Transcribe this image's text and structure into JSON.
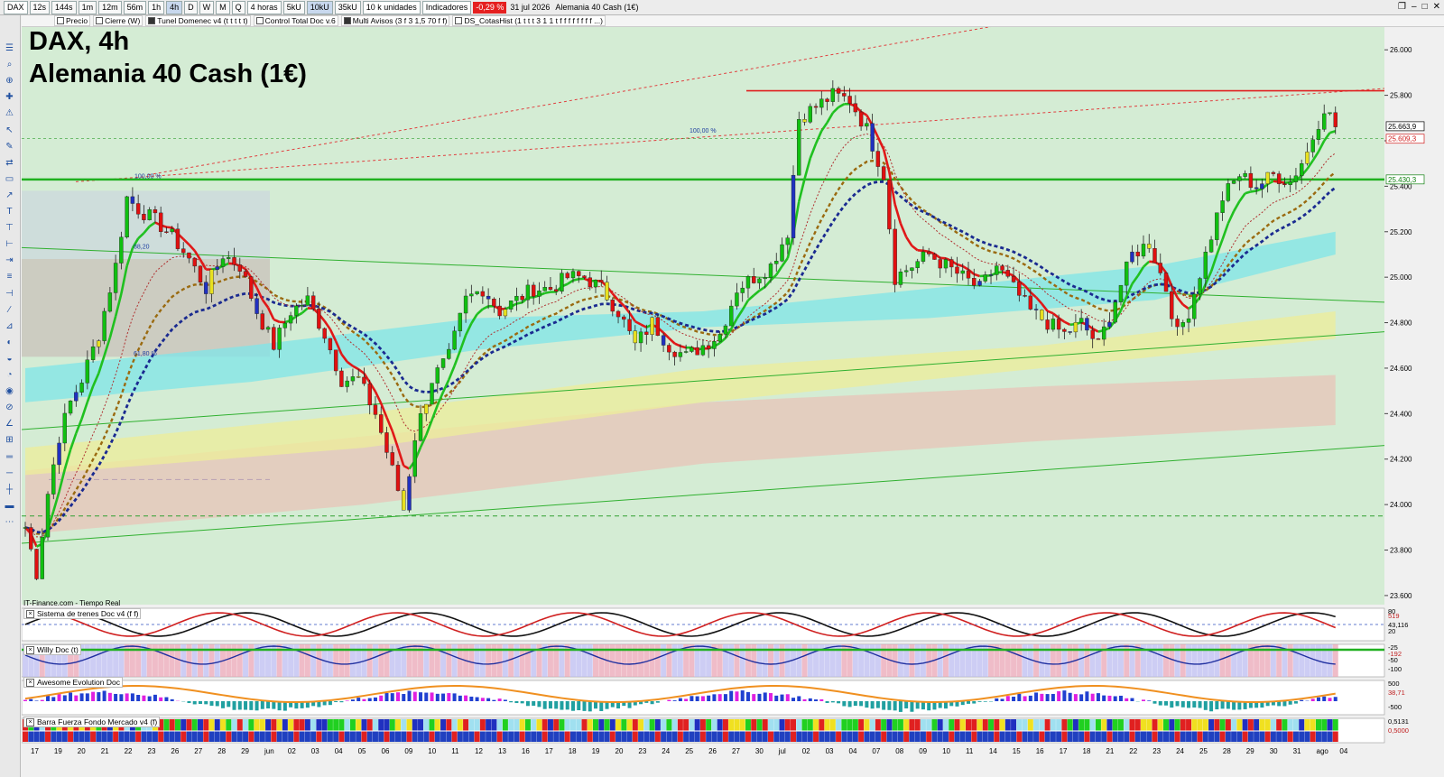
{
  "toolbar": {
    "symbol": "DAX",
    "timeframes": [
      "12s",
      "144s",
      "1m",
      "12m",
      "56m",
      "1h",
      "4h",
      "D",
      "W",
      "M",
      "Q"
    ],
    "active_timeframe": "4h",
    "period_select": "4 horas",
    "units": [
      "5kU",
      "10kU",
      "35kU"
    ],
    "active_unit": "10kU",
    "units_select": "10 k unidades",
    "indicators_label": "Indicadores",
    "change_badge": "-0,29 %",
    "date": "31 jul 2026",
    "instrument": "Alemania 40 Cash (1€)"
  },
  "indicators_bar": [
    {
      "label": "Precio",
      "checked": false
    },
    {
      "label": "Cierre (W)",
      "checked": false
    },
    {
      "label": "Tunel Domenec v4 (t t t t t)",
      "checked": true
    },
    {
      "label": "Control Total Doc v.6",
      "checked": false
    },
    {
      "label": "Multi Avisos (3 f 3 1,5 70 f f)",
      "checked": true
    },
    {
      "label": "DS_CotasHist (1 t t t 3 1 1 t f f f f f f f f ...)",
      "checked": false
    }
  ],
  "title_line1": "DAX, 4h",
  "title_line2": "Alemania 40 Cash (1€)",
  "source_label": "IT-Finance.com - Tiempo Real",
  "colors": {
    "background": "#d4ecd4",
    "support_line": "#20b020",
    "resistance_line": "#e02020",
    "bull_candle": "#10c010",
    "bear_candle": "#e01010",
    "ma_fast_up": "#20c020",
    "ma_fast_down": "#e01818",
    "ma_dotted_navy": "#1a2a90",
    "ma_dotted_brown": "#9a6a10",
    "cloud_cyan": "#7fe6e8",
    "cloud_yellow": "#eeee99",
    "cloud_brown": "#e8c4b8"
  },
  "price_labels": {
    "current": "25.663,9",
    "red_level": "25.609,3",
    "green_level": "25.430,3"
  },
  "fib_labels": [
    "100,00 %",
    "88,20",
    "61,80 %",
    "100,00 %"
  ],
  "panels": [
    {
      "label": "Sistema de trenes Doc v4 (f f)",
      "values": [
        "80",
        "519",
        "43,116",
        "20"
      ]
    },
    {
      "label": "Willy Doc (t)",
      "values": [
        "-25",
        "-192",
        "-50",
        "-100"
      ]
    },
    {
      "label": "Awesome Evolution Doc",
      "values": [
        "500",
        "38,71",
        "-500"
      ]
    },
    {
      "label": "Barra Fuerza Fondo Mercado v4 (f)",
      "values": [
        "0,5131",
        "0,5000"
      ]
    }
  ],
  "chart_data": {
    "type": "candlestick",
    "y_ticks": [
      "26.000",
      "25.800",
      "25.600",
      "25.400",
      "25.200",
      "25.000",
      "24.800",
      "24.600",
      "24.400",
      "24.200",
      "24.000",
      "23.800",
      "23.600"
    ],
    "ylim": [
      23560,
      26100
    ],
    "x_ticks": [
      "17",
      "19",
      "20",
      "21",
      "22",
      "23",
      "26",
      "27",
      "28",
      "29",
      "jun",
      "02",
      "03",
      "04",
      "05",
      "06",
      "09",
      "10",
      "11",
      "12",
      "13",
      "16",
      "17",
      "18",
      "19",
      "20",
      "23",
      "24",
      "25",
      "26",
      "27",
      "30",
      "jul",
      "02",
      "03",
      "04",
      "07",
      "08",
      "09",
      "10",
      "11",
      "14",
      "15",
      "16",
      "17",
      "18",
      "21",
      "22",
      "23",
      "24",
      "25",
      "28",
      "29",
      "30",
      "31",
      "ago",
      "04"
    ],
    "close_path": [
      [
        0,
        23900
      ],
      [
        2,
        23700
      ],
      [
        4,
        24050
      ],
      [
        6,
        24300
      ],
      [
        8,
        24450
      ],
      [
        10,
        24550
      ],
      [
        13,
        24750
      ],
      [
        16,
        25050
      ],
      [
        18,
        25350
      ],
      [
        20,
        25300
      ],
      [
        23,
        25250
      ],
      [
        26,
        25180
      ],
      [
        29,
        25080
      ],
      [
        32,
        24950
      ],
      [
        35,
        25100
      ],
      [
        38,
        25050
      ],
      [
        41,
        24850
      ],
      [
        44,
        24700
      ],
      [
        47,
        24850
      ],
      [
        50,
        24900
      ],
      [
        53,
        24750
      ],
      [
        56,
        24550
      ],
      [
        59,
        24550
      ],
      [
        62,
        24400
      ],
      [
        65,
        24150
      ],
      [
        67,
        23980
      ],
      [
        69,
        24300
      ],
      [
        72,
        24550
      ],
      [
        75,
        24650
      ],
      [
        78,
        24900
      ],
      [
        81,
        24950
      ],
      [
        84,
        24850
      ],
      [
        87,
        24900
      ],
      [
        90,
        24950
      ],
      [
        93,
        24950
      ],
      [
        96,
        25000
      ],
      [
        99,
        25000
      ],
      [
        102,
        24950
      ],
      [
        105,
        24850
      ],
      [
        108,
        24700
      ],
      [
        111,
        24800
      ],
      [
        114,
        24700
      ],
      [
        117,
        24650
      ],
      [
        120,
        24700
      ],
      [
        123,
        24750
      ],
      [
        126,
        24950
      ],
      [
        129,
        25000
      ],
      [
        132,
        25050
      ],
      [
        135,
        25200
      ],
      [
        137,
        25700
      ],
      [
        140,
        25750
      ],
      [
        143,
        25800
      ],
      [
        146,
        25780
      ],
      [
        149,
        25650
      ],
      [
        152,
        25450
      ],
      [
        154,
        25000
      ],
      [
        157,
        25050
      ],
      [
        160,
        25100
      ],
      [
        163,
        25050
      ],
      [
        166,
        25000
      ],
      [
        169,
        24950
      ],
      [
        172,
        25050
      ],
      [
        175,
        24950
      ],
      [
        178,
        24850
      ],
      [
        181,
        24800
      ],
      [
        184,
        24750
      ],
      [
        187,
        24800
      ],
      [
        190,
        24700
      ],
      [
        193,
        24900
      ],
      [
        196,
        25100
      ],
      [
        199,
        25150
      ],
      [
        202,
        24950
      ],
      [
        204,
        24750
      ],
      [
        206,
        24850
      ],
      [
        209,
        25100
      ],
      [
        212,
        25350
      ],
      [
        215,
        25450
      ],
      [
        218,
        25400
      ],
      [
        221,
        25450
      ],
      [
        224,
        25420
      ],
      [
        227,
        25550
      ],
      [
        230,
        25750
      ],
      [
        232,
        25664
      ]
    ],
    "support_level": 25430,
    "resistance_level": 25820,
    "current_price": 25663.9
  }
}
